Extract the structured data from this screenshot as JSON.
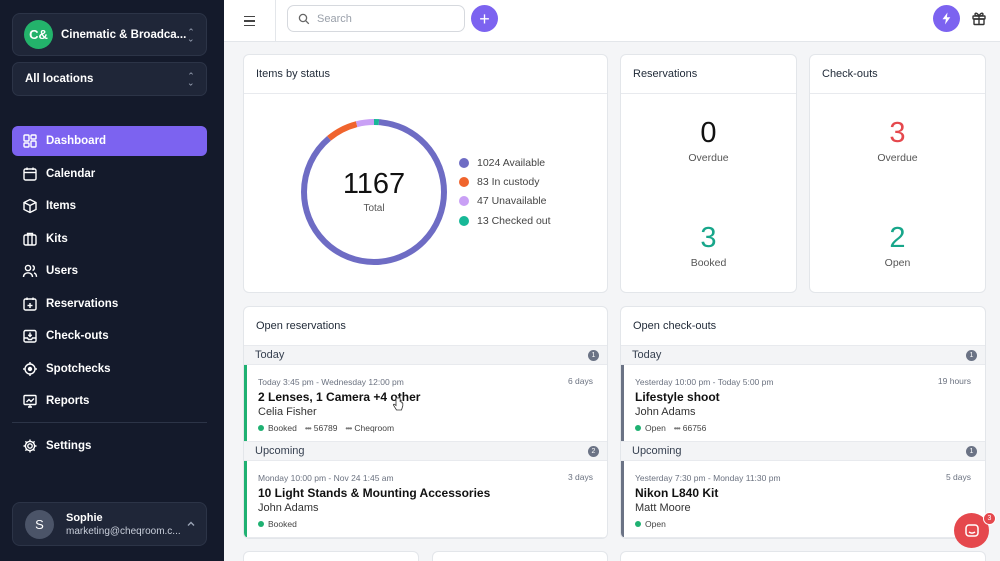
{
  "sidebar": {
    "org_initials": "C&",
    "org_name": "Cinematic & Broadca...",
    "location": "All locations",
    "items": [
      {
        "label": "Dashboard",
        "icon": "dashboard-icon"
      },
      {
        "label": "Calendar",
        "icon": "calendar-icon"
      },
      {
        "label": "Items",
        "icon": "cube-icon"
      },
      {
        "label": "Kits",
        "icon": "kit-icon"
      },
      {
        "label": "Users",
        "icon": "users-icon"
      },
      {
        "label": "Reservations",
        "icon": "reservation-icon"
      },
      {
        "label": "Check-outs",
        "icon": "checkout-icon"
      },
      {
        "label": "Spotchecks",
        "icon": "target-icon"
      },
      {
        "label": "Reports",
        "icon": "reports-icon"
      }
    ],
    "settings_label": "Settings",
    "user": {
      "initial": "S",
      "name": "Sophie",
      "email": "marketing@cheqroom.c..."
    }
  },
  "topbar": {
    "search_placeholder": "Search",
    "add_label": "+"
  },
  "items_by_status": {
    "title": "Items by status",
    "total": "1167",
    "total_label": "Total",
    "legend": [
      {
        "label": "1024 Available",
        "value": 1024,
        "color": "#6e6cc4"
      },
      {
        "label": "83 In custody",
        "value": 83,
        "color": "#f0642d"
      },
      {
        "label": "47 Unavailable",
        "value": 47,
        "color": "#c9a0f5"
      },
      {
        "label": "13 Checked out",
        "value": 13,
        "color": "#17b897"
      }
    ]
  },
  "reservations": {
    "title": "Reservations",
    "overdue_num": "0",
    "overdue_label": "Overdue",
    "booked_num": "3",
    "booked_label": "Booked"
  },
  "checkouts": {
    "title": "Check-outs",
    "overdue_num": "3",
    "overdue_label": "Overdue",
    "open_num": "2",
    "open_label": "Open"
  },
  "open_reservations": {
    "title": "Open reservations",
    "today_label": "Today",
    "today_count": "1",
    "today_entry": {
      "when": "Today 3:45 pm - Wednesday 12:00 pm",
      "duration": "6 days",
      "title": "2 Lenses, 1 Camera +4 other",
      "person": "Celia Fisher",
      "status": "Booked",
      "code": "56789",
      "location": "Cheqroom"
    },
    "upcoming_label": "Upcoming",
    "upcoming_count": "2",
    "upcoming_entry": {
      "when": "Monday 10:00 pm - Nov 24 1:45 am",
      "duration": "3 days",
      "title": "10 Light Stands & Mounting Accessories",
      "person": "John Adams",
      "status": "Booked"
    }
  },
  "open_checkouts": {
    "title": "Open check-outs",
    "today_label": "Today",
    "today_count": "1",
    "today_entry": {
      "when": "Yesterday 10:00 pm - Today 5:00 pm",
      "duration": "19 hours",
      "title": "Lifestyle shoot",
      "person": "John Adams",
      "status": "Open",
      "code": "66756"
    },
    "upcoming_label": "Upcoming",
    "upcoming_count": "1",
    "upcoming_entry": {
      "when": "Yesterday 7:30 pm - Monday 11:30 pm",
      "duration": "5 days",
      "title": "Nikon L840 Kit",
      "person": "Matt Moore",
      "status": "Open"
    }
  },
  "chat": {
    "badge": "3"
  },
  "colors": {
    "accent": "#7c63f0",
    "green": "#1fb172",
    "red": "#e5484d",
    "teal": "#17a68a"
  }
}
